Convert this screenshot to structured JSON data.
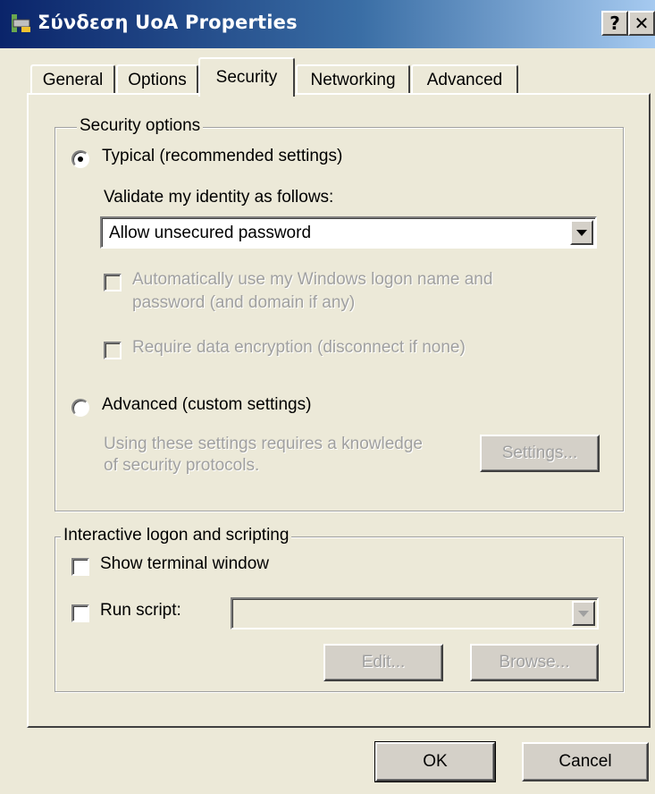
{
  "window": {
    "title": "Σύνδεση UoA Properties",
    "help_label": "?",
    "close_label": "✕"
  },
  "tabs": [
    {
      "label": "General",
      "active": false
    },
    {
      "label": "Options",
      "active": false
    },
    {
      "label": "Security",
      "active": true
    },
    {
      "label": "Networking",
      "active": false
    },
    {
      "label": "Advanced",
      "active": false
    }
  ],
  "security_options": {
    "group_title": "Security options",
    "typical_label": "Typical (recommended settings)",
    "typical_selected": true,
    "validate_label": "Validate my identity as follows:",
    "validate_value": "Allow unsecured password",
    "auto_logon_label_line1": "Automatically use my Windows logon name and",
    "auto_logon_label_line2": "password (and domain if any)",
    "require_encryption_label": "Require data encryption (disconnect if none)",
    "advanced_label": "Advanced (custom settings)",
    "advanced_selected": false,
    "advanced_desc_line1": "Using these settings requires a knowledge",
    "advanced_desc_line2": "of security protocols.",
    "settings_button": "Settings..."
  },
  "interactive": {
    "group_title": "Interactive logon and scripting",
    "show_terminal_label": "Show terminal window",
    "run_script_label": "Run script:",
    "edit_button": "Edit...",
    "browse_button": "Browse..."
  },
  "footer": {
    "ok_button": "OK",
    "cancel_button": "Cancel"
  },
  "icons": {
    "title_icon": "network-connection-icon",
    "radio_dot": "radio-dot-icon",
    "dropdown_arrow": "chevron-down-icon"
  }
}
